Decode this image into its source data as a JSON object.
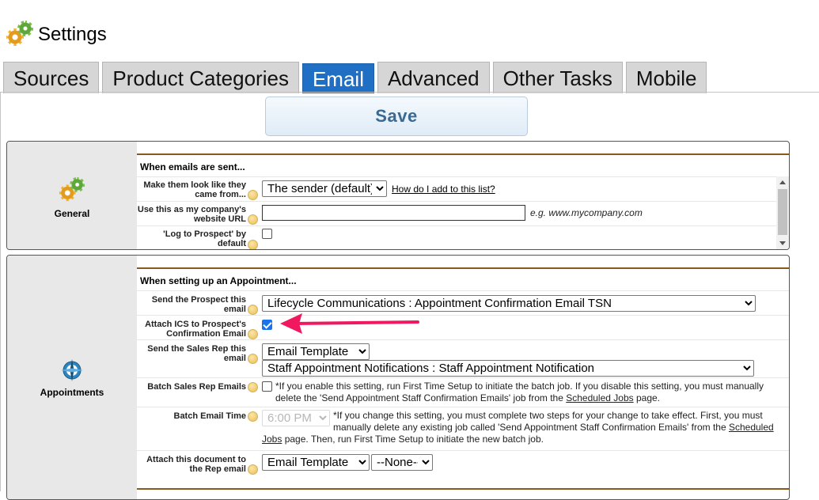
{
  "page": {
    "title": "Settings"
  },
  "tabs": [
    {
      "label": "Sources"
    },
    {
      "label": "Product Categories"
    },
    {
      "label": "Email",
      "active": true
    },
    {
      "label": "Advanced"
    },
    {
      "label": "Other Tasks"
    },
    {
      "label": "Mobile"
    }
  ],
  "toolbar": {
    "save_label": "Save"
  },
  "general": {
    "side_label": "General",
    "section_title": "When emails are sent...",
    "rows": {
      "sender_label": "Make them look like they came from...",
      "sender_value": "The sender (default)",
      "sender_link": "How do I add to this list?",
      "url_label": "Use this as my company's website URL",
      "url_value": "",
      "url_example": "e.g. www.mycompany.com",
      "log_label": "'Log to Prospect' by default",
      "log_checked": false
    }
  },
  "appointments": {
    "side_label": "Appointments",
    "section_title": "When setting up an Appointment...",
    "rows": {
      "send_prospect_label": "Send the Prospect this email",
      "send_prospect_value": "Lifecycle Communications : Appointment Confirmation Email TSN",
      "attach_ics_label": "Attach ICS to Prospect's Confirmation Email",
      "attach_ics_checked": true,
      "send_rep_label": "Send the Sales Rep this email",
      "send_rep_type": "Email Template",
      "send_rep_value": "Staff Appointment Notifications : Staff Appointment Notification",
      "batch_label": "Batch Sales Rep Emails",
      "batch_checked": false,
      "batch_note_1": "*If you enable this setting, run First Time Setup to initiate the batch job. If you disable this setting, you must manually delete the 'Send Appointment Staff Confirmation Emails' job from the ",
      "batch_note_link": "Scheduled Jobs",
      "batch_note_2": " page.",
      "batch_time_label": "Batch Email Time",
      "batch_time_value": "6:00 PM",
      "batch_time_note_1": "*If you change this setting, you must complete two steps for your change to take effect. First, you must manually delete any existing job called 'Send Appointment Staff Confirmation Emails' from the ",
      "batch_time_note_link": "Scheduled Jobs",
      "batch_time_note_2": " page. Then, run First Time Setup to initiate the new batch job.",
      "attach_doc_label": "Attach this document to the Rep email",
      "attach_doc_type": "Email Template",
      "attach_doc_value": "--None--"
    }
  },
  "colors": {
    "active_tab": "#1f6fc5",
    "section_rule": "#8b5a1b",
    "arrow": "#f0195f"
  }
}
